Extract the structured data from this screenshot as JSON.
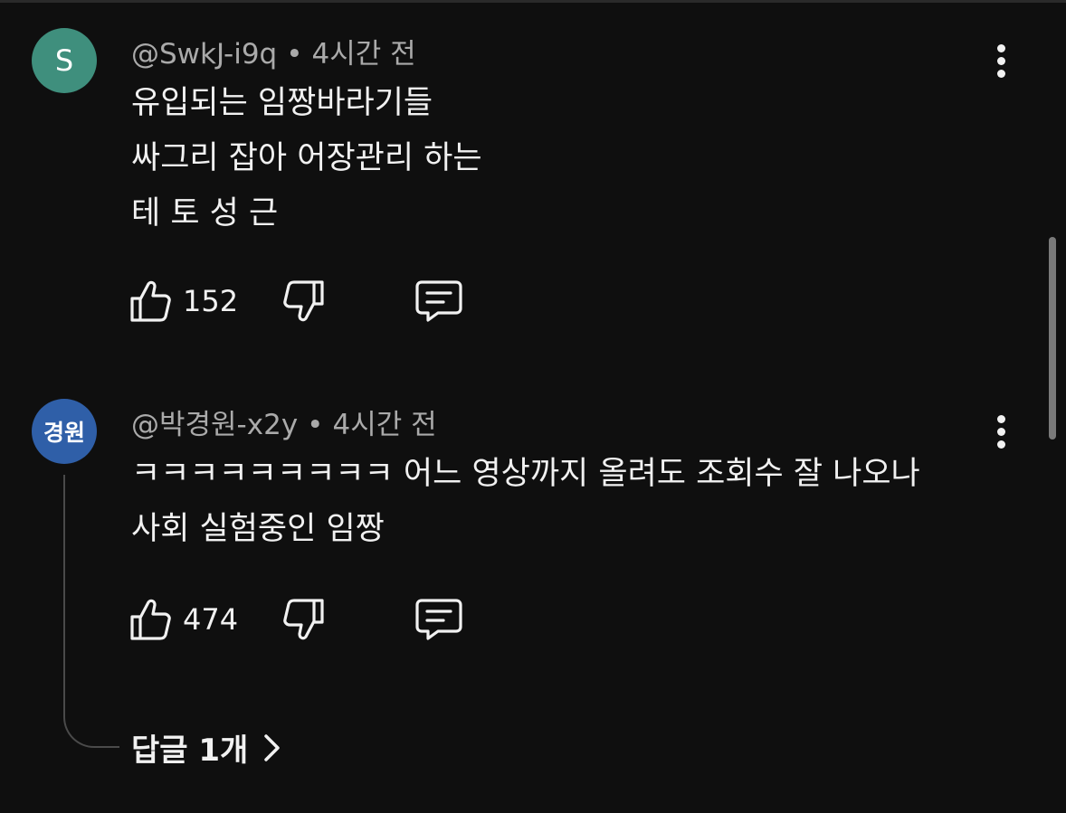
{
  "comments": [
    {
      "avatar_text": "S",
      "avatar_color": "#3f8f7d",
      "author": "@SwkJ-i9q",
      "separator": "•",
      "time": "4시간 전",
      "lines": [
        "유입되는 임짱바라기들",
        "싸그리 잡아 어장관리 하는",
        "테 토 성 근"
      ],
      "like_count": "152",
      "icons": {
        "like": "thumbs-up-icon",
        "dislike": "thumbs-down-icon",
        "reply": "comment-icon",
        "menu": "more-vertical-icon"
      }
    },
    {
      "avatar_text": "경원",
      "avatar_color": "#2f5fa8",
      "author": "@박경원-x2y",
      "separator": "•",
      "time": "4시간 전",
      "lines": [
        "ㅋㅋㅋㅋㅋㅋㅋㅋㅋ 어느 영상까지 올려도 조회수 잘 나오나",
        "사회 실험중인 임짱"
      ],
      "like_count": "474",
      "replies_label": "답글 1개",
      "icons": {
        "like": "thumbs-up-icon",
        "dislike": "thumbs-down-icon",
        "reply": "comment-icon",
        "menu": "more-vertical-icon",
        "expand": "chevron-right-icon"
      }
    }
  ]
}
